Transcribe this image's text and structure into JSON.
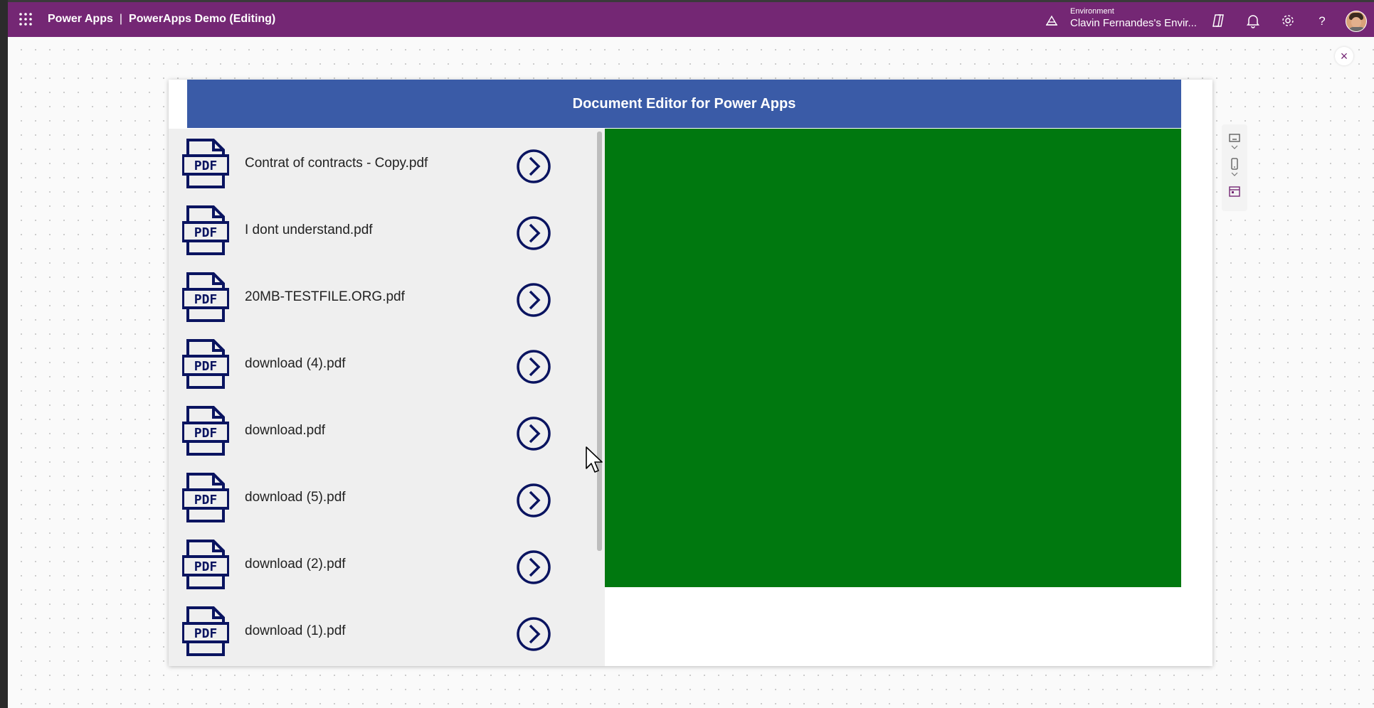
{
  "topbar": {
    "app_name": "Power Apps",
    "separator": "|",
    "document_title": "PowerApps Demo (Editing)",
    "environment_label": "Environment",
    "environment_name": "Clavin Fernandes's Envir..."
  },
  "canvas": {
    "close_glyph": "×"
  },
  "app": {
    "header_title": "Document Editor for Power Apps",
    "files": [
      {
        "name": "Contrat of contracts - Copy.pdf"
      },
      {
        "name": "I dont understand.pdf"
      },
      {
        "name": "20MB-TESTFILE.ORG.pdf"
      },
      {
        "name": "download (4).pdf"
      },
      {
        "name": "download.pdf"
      },
      {
        "name": "download (5).pdf"
      },
      {
        "name": "download (2).pdf"
      },
      {
        "name": "download (1).pdf"
      }
    ],
    "pdf_icon_text": "PDF"
  },
  "colors": {
    "topbar": "#742774",
    "header": "#3a5ba7",
    "preview_panel": "#00780f",
    "icon_navy": "#0a1460",
    "gallery_bg": "#efefef"
  },
  "icons": [
    "waffle-icon",
    "environment-icon",
    "copilot-icon",
    "bell-icon",
    "gear-icon",
    "help-icon",
    "pdf-file-icon",
    "chevron-right-circle-icon",
    "close-icon",
    "desktop-icon",
    "phone-icon",
    "calendar-icon"
  ]
}
